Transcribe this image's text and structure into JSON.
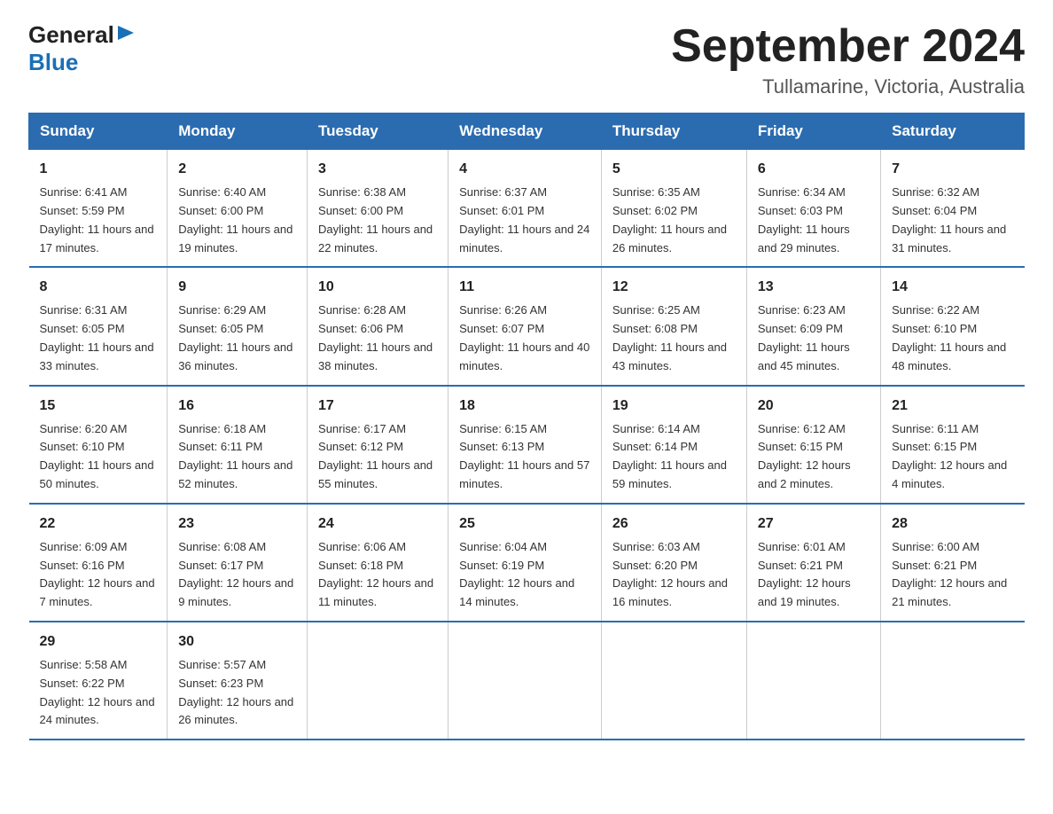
{
  "logo": {
    "general": "General",
    "blue": "Blue"
  },
  "title": "September 2024",
  "subtitle": "Tullamarine, Victoria, Australia",
  "headers": [
    "Sunday",
    "Monday",
    "Tuesday",
    "Wednesday",
    "Thursday",
    "Friday",
    "Saturday"
  ],
  "weeks": [
    [
      {
        "day": "1",
        "sunrise": "Sunrise: 6:41 AM",
        "sunset": "Sunset: 5:59 PM",
        "daylight": "Daylight: 11 hours and 17 minutes."
      },
      {
        "day": "2",
        "sunrise": "Sunrise: 6:40 AM",
        "sunset": "Sunset: 6:00 PM",
        "daylight": "Daylight: 11 hours and 19 minutes."
      },
      {
        "day": "3",
        "sunrise": "Sunrise: 6:38 AM",
        "sunset": "Sunset: 6:00 PM",
        "daylight": "Daylight: 11 hours and 22 minutes."
      },
      {
        "day": "4",
        "sunrise": "Sunrise: 6:37 AM",
        "sunset": "Sunset: 6:01 PM",
        "daylight": "Daylight: 11 hours and 24 minutes."
      },
      {
        "day": "5",
        "sunrise": "Sunrise: 6:35 AM",
        "sunset": "Sunset: 6:02 PM",
        "daylight": "Daylight: 11 hours and 26 minutes."
      },
      {
        "day": "6",
        "sunrise": "Sunrise: 6:34 AM",
        "sunset": "Sunset: 6:03 PM",
        "daylight": "Daylight: 11 hours and 29 minutes."
      },
      {
        "day": "7",
        "sunrise": "Sunrise: 6:32 AM",
        "sunset": "Sunset: 6:04 PM",
        "daylight": "Daylight: 11 hours and 31 minutes."
      }
    ],
    [
      {
        "day": "8",
        "sunrise": "Sunrise: 6:31 AM",
        "sunset": "Sunset: 6:05 PM",
        "daylight": "Daylight: 11 hours and 33 minutes."
      },
      {
        "day": "9",
        "sunrise": "Sunrise: 6:29 AM",
        "sunset": "Sunset: 6:05 PM",
        "daylight": "Daylight: 11 hours and 36 minutes."
      },
      {
        "day": "10",
        "sunrise": "Sunrise: 6:28 AM",
        "sunset": "Sunset: 6:06 PM",
        "daylight": "Daylight: 11 hours and 38 minutes."
      },
      {
        "day": "11",
        "sunrise": "Sunrise: 6:26 AM",
        "sunset": "Sunset: 6:07 PM",
        "daylight": "Daylight: 11 hours and 40 minutes."
      },
      {
        "day": "12",
        "sunrise": "Sunrise: 6:25 AM",
        "sunset": "Sunset: 6:08 PM",
        "daylight": "Daylight: 11 hours and 43 minutes."
      },
      {
        "day": "13",
        "sunrise": "Sunrise: 6:23 AM",
        "sunset": "Sunset: 6:09 PM",
        "daylight": "Daylight: 11 hours and 45 minutes."
      },
      {
        "day": "14",
        "sunrise": "Sunrise: 6:22 AM",
        "sunset": "Sunset: 6:10 PM",
        "daylight": "Daylight: 11 hours and 48 minutes."
      }
    ],
    [
      {
        "day": "15",
        "sunrise": "Sunrise: 6:20 AM",
        "sunset": "Sunset: 6:10 PM",
        "daylight": "Daylight: 11 hours and 50 minutes."
      },
      {
        "day": "16",
        "sunrise": "Sunrise: 6:18 AM",
        "sunset": "Sunset: 6:11 PM",
        "daylight": "Daylight: 11 hours and 52 minutes."
      },
      {
        "day": "17",
        "sunrise": "Sunrise: 6:17 AM",
        "sunset": "Sunset: 6:12 PM",
        "daylight": "Daylight: 11 hours and 55 minutes."
      },
      {
        "day": "18",
        "sunrise": "Sunrise: 6:15 AM",
        "sunset": "Sunset: 6:13 PM",
        "daylight": "Daylight: 11 hours and 57 minutes."
      },
      {
        "day": "19",
        "sunrise": "Sunrise: 6:14 AM",
        "sunset": "Sunset: 6:14 PM",
        "daylight": "Daylight: 11 hours and 59 minutes."
      },
      {
        "day": "20",
        "sunrise": "Sunrise: 6:12 AM",
        "sunset": "Sunset: 6:15 PM",
        "daylight": "Daylight: 12 hours and 2 minutes."
      },
      {
        "day": "21",
        "sunrise": "Sunrise: 6:11 AM",
        "sunset": "Sunset: 6:15 PM",
        "daylight": "Daylight: 12 hours and 4 minutes."
      }
    ],
    [
      {
        "day": "22",
        "sunrise": "Sunrise: 6:09 AM",
        "sunset": "Sunset: 6:16 PM",
        "daylight": "Daylight: 12 hours and 7 minutes."
      },
      {
        "day": "23",
        "sunrise": "Sunrise: 6:08 AM",
        "sunset": "Sunset: 6:17 PM",
        "daylight": "Daylight: 12 hours and 9 minutes."
      },
      {
        "day": "24",
        "sunrise": "Sunrise: 6:06 AM",
        "sunset": "Sunset: 6:18 PM",
        "daylight": "Daylight: 12 hours and 11 minutes."
      },
      {
        "day": "25",
        "sunrise": "Sunrise: 6:04 AM",
        "sunset": "Sunset: 6:19 PM",
        "daylight": "Daylight: 12 hours and 14 minutes."
      },
      {
        "day": "26",
        "sunrise": "Sunrise: 6:03 AM",
        "sunset": "Sunset: 6:20 PM",
        "daylight": "Daylight: 12 hours and 16 minutes."
      },
      {
        "day": "27",
        "sunrise": "Sunrise: 6:01 AM",
        "sunset": "Sunset: 6:21 PM",
        "daylight": "Daylight: 12 hours and 19 minutes."
      },
      {
        "day": "28",
        "sunrise": "Sunrise: 6:00 AM",
        "sunset": "Sunset: 6:21 PM",
        "daylight": "Daylight: 12 hours and 21 minutes."
      }
    ],
    [
      {
        "day": "29",
        "sunrise": "Sunrise: 5:58 AM",
        "sunset": "Sunset: 6:22 PM",
        "daylight": "Daylight: 12 hours and 24 minutes."
      },
      {
        "day": "30",
        "sunrise": "Sunrise: 5:57 AM",
        "sunset": "Sunset: 6:23 PM",
        "daylight": "Daylight: 12 hours and 26 minutes."
      },
      null,
      null,
      null,
      null,
      null
    ]
  ]
}
